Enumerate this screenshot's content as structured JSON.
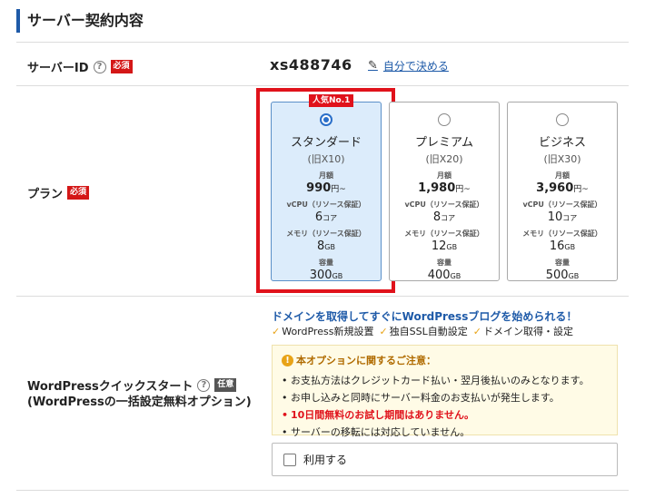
{
  "section": {
    "title": "サーバー契約内容"
  },
  "server_id": {
    "label": "サーバーID",
    "required": "必須",
    "value": "xs488746",
    "link": "自分で決める"
  },
  "plan_row": {
    "label": "プラン",
    "required": "必須",
    "badge": "人気No.1",
    "plans": [
      {
        "name": "スタンダード",
        "old": "(旧X10)",
        "price_label": "月額",
        "price": "990",
        "price_unit": "円~",
        "cpu_label": "vCPU（リソース保証）",
        "cpu": "6",
        "cpu_unit": "コア",
        "mem_label": "メモリ（リソース保証）",
        "mem": "8",
        "mem_unit": "GB",
        "disk_label": "容量",
        "disk": "300",
        "disk_unit": "GB",
        "selected": true
      },
      {
        "name": "プレミアム",
        "old": "(旧X20)",
        "price_label": "月額",
        "price": "1,980",
        "price_unit": "円~",
        "cpu_label": "vCPU（リソース保証）",
        "cpu": "8",
        "cpu_unit": "コア",
        "mem_label": "メモリ（リソース保証）",
        "mem": "12",
        "mem_unit": "GB",
        "disk_label": "容量",
        "disk": "400",
        "disk_unit": "GB",
        "selected": false
      },
      {
        "name": "ビジネス",
        "old": "(旧X30)",
        "price_label": "月額",
        "price": "3,960",
        "price_unit": "円~",
        "cpu_label": "vCPU（リソース保証）",
        "cpu": "10",
        "cpu_unit": "コア",
        "mem_label": "メモリ（リソース保証）",
        "mem": "16",
        "mem_unit": "GB",
        "disk_label": "容量",
        "disk": "500",
        "disk_unit": "GB",
        "selected": false
      }
    ]
  },
  "wp": {
    "label_line1": "WordPressクイックスタート",
    "optional": "任意",
    "label_line2": "(WordPressの一括設定無料オプション)",
    "lead": "ドメインを取得してすぐにWordPressブログを始められる！",
    "features": [
      "WordPress新規設置",
      "独自SSL自動設定",
      "ドメイン取得・設定"
    ],
    "notice_title": "本オプションに関するご注意：",
    "notice_items": [
      "お支払方法はクレジットカード払い・翌月後払いのみとなります。",
      "お申し込みと同時にサーバー料金のお支払いが発生します。",
      "10日間無料のお試し期間はありません。",
      "サーバーの移転には対応していません。"
    ],
    "use_label": "利用する"
  },
  "colors": {
    "accent": "#1e5aa8",
    "highlight": "#e0121b",
    "selected_bg": "#dcecfb"
  },
  "icons": {
    "help": "question-circle-icon",
    "edit": "pencil-icon",
    "check": "checkmark-icon",
    "alert": "exclamation-circle-icon"
  }
}
